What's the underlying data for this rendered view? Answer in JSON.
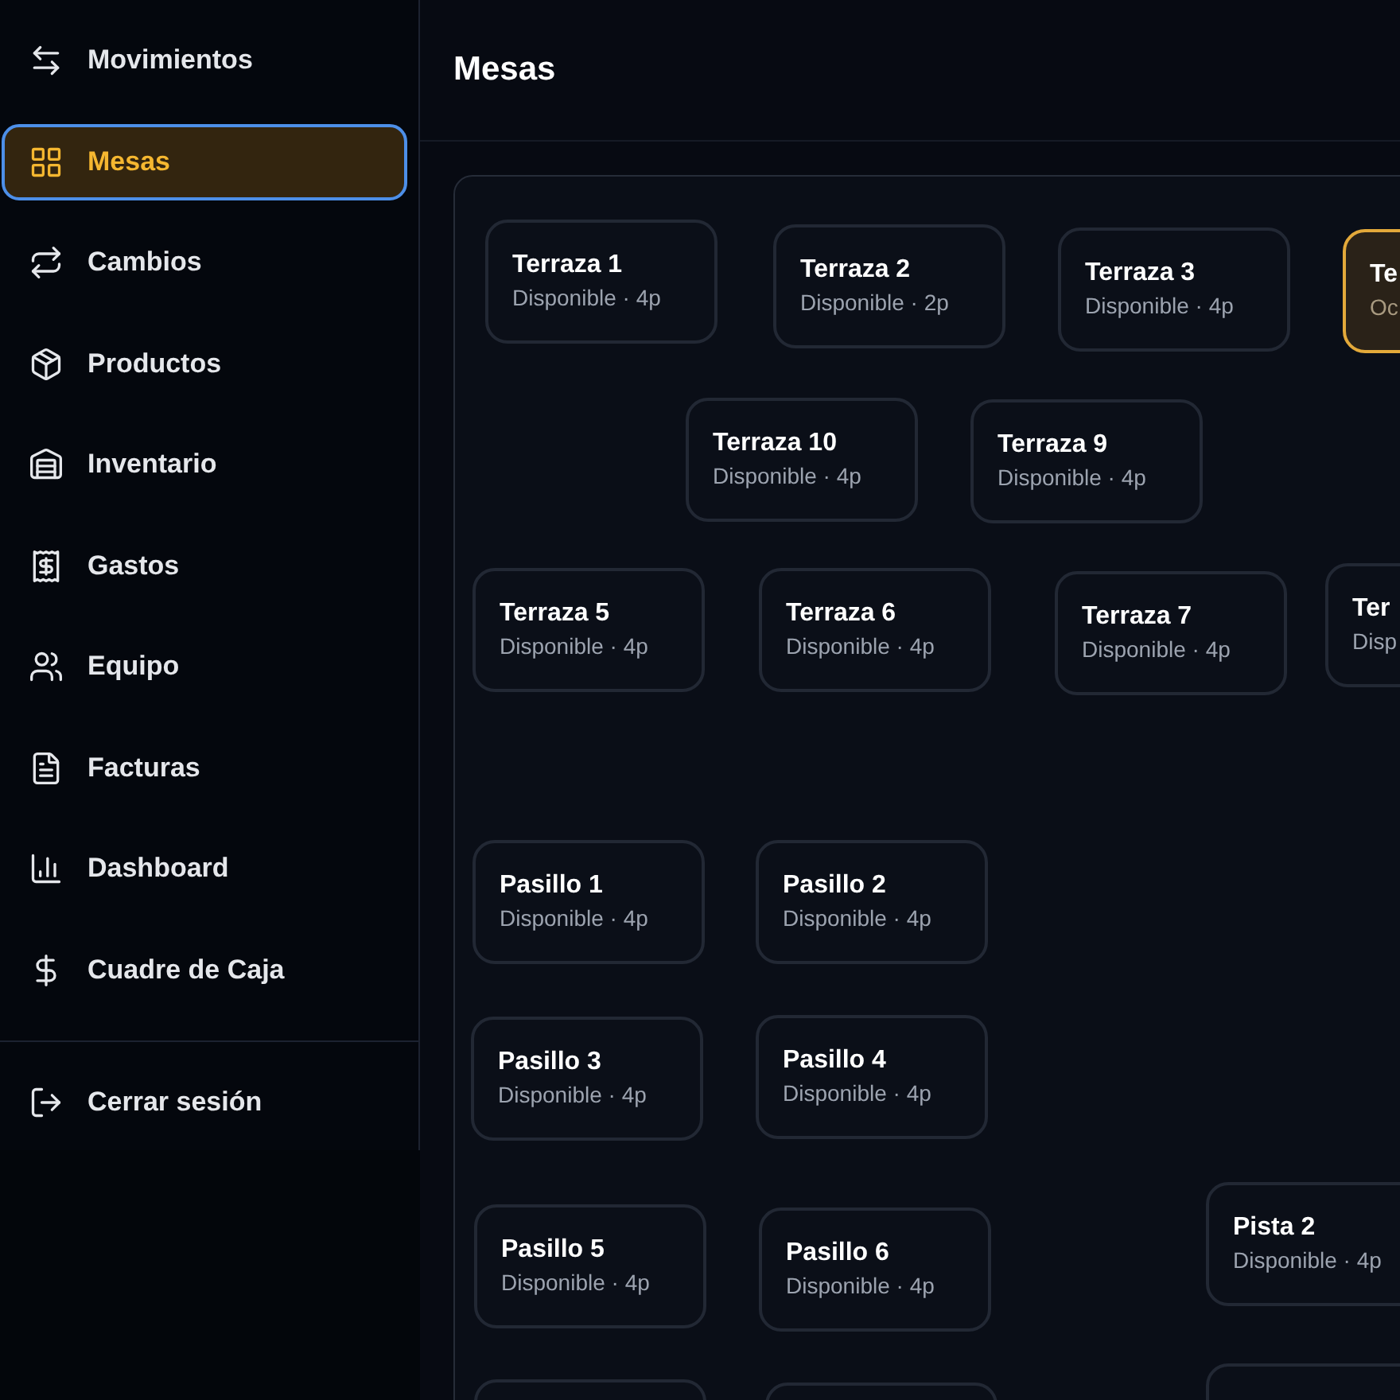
{
  "sidebar": {
    "items": [
      {
        "label": "Movimientos",
        "selected": false
      },
      {
        "label": "Mesas",
        "selected": true
      },
      {
        "label": "Cambios",
        "selected": false
      },
      {
        "label": "Productos",
        "selected": false
      },
      {
        "label": "Inventario",
        "selected": false
      },
      {
        "label": "Gastos",
        "selected": false
      },
      {
        "label": "Equipo",
        "selected": false
      },
      {
        "label": "Facturas",
        "selected": false
      },
      {
        "label": "Dashboard",
        "selected": false
      },
      {
        "label": "Cuadre de Caja",
        "selected": false
      }
    ],
    "logout": "Cerrar sesión"
  },
  "header": {
    "title": "Mesas"
  },
  "tables": [
    {
      "name": "Terraza 1",
      "detail": "Disponible · 4p",
      "occupied": false
    },
    {
      "name": "Terraza 2",
      "detail": "Disponible · 2p",
      "occupied": false
    },
    {
      "name": "Terraza 3",
      "detail": "Disponible · 4p",
      "occupied": false
    },
    {
      "name": "Te",
      "detail": "Oc",
      "occupied": true
    },
    {
      "name": "Terraza 10",
      "detail": "Disponible · 4p",
      "occupied": false
    },
    {
      "name": "Terraza 9",
      "detail": "Disponible · 4p",
      "occupied": false
    },
    {
      "name": "Terraza 5",
      "detail": "Disponible · 4p",
      "occupied": false
    },
    {
      "name": "Terraza 6",
      "detail": "Disponible · 4p",
      "occupied": false
    },
    {
      "name": "Terraza 7",
      "detail": "Disponible · 4p",
      "occupied": false
    },
    {
      "name": "Ter",
      "detail": "Disp",
      "occupied": false
    },
    {
      "name": "Pasillo 1",
      "detail": "Disponible · 4p",
      "occupied": false
    },
    {
      "name": "Pasillo 2",
      "detail": "Disponible · 4p",
      "occupied": false
    },
    {
      "name": "Pasillo 3",
      "detail": "Disponible · 4p",
      "occupied": false
    },
    {
      "name": "Pasillo 4",
      "detail": "Disponible · 4p",
      "occupied": false
    },
    {
      "name": "Pasillo 5",
      "detail": "Disponible · 4p",
      "occupied": false
    },
    {
      "name": "Pasillo 6",
      "detail": "Disponible · 4p",
      "occupied": false
    },
    {
      "name": "Pista 2",
      "detail": "Disponible · 4p",
      "occupied": false
    },
    {
      "occupied": false
    },
    {
      "occupied": false
    },
    {
      "occupied": false
    }
  ]
}
